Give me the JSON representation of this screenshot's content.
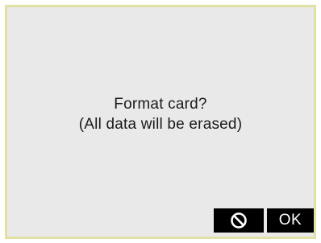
{
  "dialog": {
    "message_line1": "Format card?",
    "message_line2": "(All data will be erased)"
  },
  "buttons": {
    "cancel_icon": "prohibited-icon",
    "ok_label": "OK"
  },
  "colors": {
    "frame_border": "#e3e0a6",
    "dialog_background": "#e9e9e9",
    "button_background": "#000000",
    "button_foreground": "#ffffff"
  }
}
